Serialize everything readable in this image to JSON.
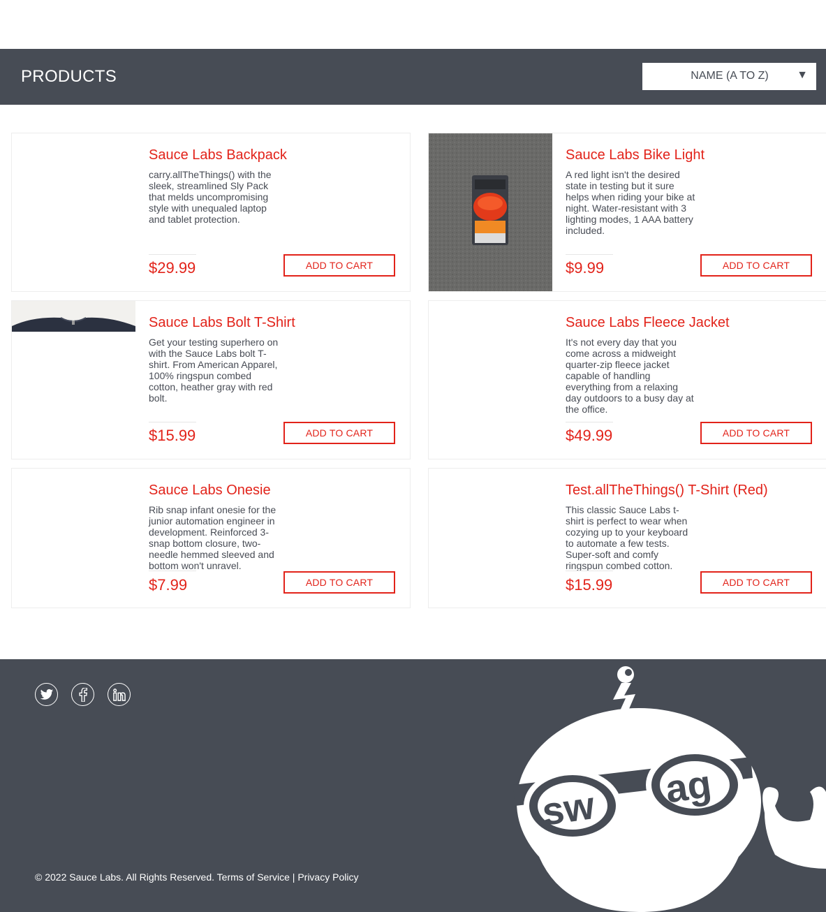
{
  "header": {
    "title": "PRODUCTS",
    "sort": {
      "selected": "NAME (A TO Z)",
      "arrow": "▼"
    }
  },
  "products": [
    {
      "name": "Sauce Labs Backpack",
      "description": "carry.allTheThings() with the sleek, streamlined Sly Pack that melds uncompromising style with unequaled laptop and tablet protection.",
      "price": "$29.99",
      "button": "ADD TO CART"
    },
    {
      "name": "Sauce Labs Bike Light",
      "description": "A red light isn't the desired state in testing but it sure helps when riding your bike at night. Water-resistant with 3 lighting modes, 1 AAA battery included.",
      "price": "$9.99",
      "button": "ADD TO CART"
    },
    {
      "name": "Sauce Labs Bolt T-Shirt",
      "description": "Get your testing superhero on with the Sauce Labs bolt T-shirt. From American Apparel, 100% ringspun combed cotton, heather gray with red bolt.",
      "price": "$15.99",
      "button": "ADD TO CART"
    },
    {
      "name": "Sauce Labs Fleece Jacket",
      "description": "It's not every day that you come across a midweight quarter-zip fleece jacket capable of handling everything from a relaxing day outdoors to a busy day at the office.",
      "price": "$49.99",
      "button": "ADD TO CART"
    },
    {
      "name": "Sauce Labs Onesie",
      "description": "Rib snap infant onesie for the junior automation engineer in development. Reinforced 3-snap bottom closure, two-needle hemmed sleeved and bottom won't unravel.",
      "price": "$7.99",
      "button": "ADD TO CART"
    },
    {
      "name": "Test.allTheThings() T-Shirt (Red)",
      "description": "This classic Sauce Labs t-shirt is perfect to wear when cozying up to your keyboard to automate a few tests. Super-soft and comfy ringspun combed cotton.",
      "price": "$15.99",
      "button": "ADD TO CART"
    }
  ],
  "footer": {
    "social": [
      "twitter-icon",
      "facebook-icon",
      "linkedin-icon"
    ],
    "copyright": "© 2022 Sauce Labs. All Rights Reserved. Terms of Service | Privacy Policy",
    "mascot_text": "swag"
  },
  "colors": {
    "header_bg": "#474c55",
    "accent": "#e2231a",
    "text_gray": "#484c55",
    "card_border": "#ededed"
  }
}
